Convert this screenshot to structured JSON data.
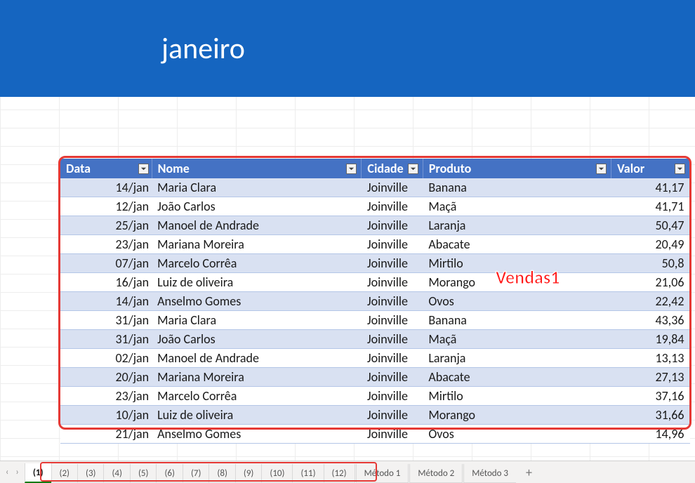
{
  "banner": {
    "title": "janeiro"
  },
  "annotation": "Vendas1",
  "table": {
    "headers": {
      "data": "Data",
      "nome": "Nome",
      "cidade": "Cidade",
      "produto": "Produto",
      "valor": "Valor"
    },
    "rows": [
      {
        "data": "14/jan",
        "nome": "Maria Clara",
        "cidade": "Joinville",
        "produto": "Banana",
        "valor": "41,17"
      },
      {
        "data": "12/jan",
        "nome": "João Carlos",
        "cidade": "Joinville",
        "produto": "Maçã",
        "valor": "41,71"
      },
      {
        "data": "25/jan",
        "nome": "Manoel de Andrade",
        "cidade": "Joinville",
        "produto": "Laranja",
        "valor": "50,47"
      },
      {
        "data": "23/jan",
        "nome": "Mariana Moreira",
        "cidade": "Joinville",
        "produto": "Abacate",
        "valor": "20,49"
      },
      {
        "data": "07/jan",
        "nome": "Marcelo Corrêa",
        "cidade": "Joinville",
        "produto": "Mirtilo",
        "valor": "50,8"
      },
      {
        "data": "16/jan",
        "nome": "Luiz de oliveira",
        "cidade": "Joinville",
        "produto": "Morango",
        "valor": "21,06"
      },
      {
        "data": "14/jan",
        "nome": "Anselmo Gomes",
        "cidade": "Joinville",
        "produto": "Ovos",
        "valor": "22,42"
      },
      {
        "data": "31/jan",
        "nome": "Maria Clara",
        "cidade": "Joinville",
        "produto": "Banana",
        "valor": "43,36"
      },
      {
        "data": "31/jan",
        "nome": "João Carlos",
        "cidade": "Joinville",
        "produto": "Maçã",
        "valor": "19,84"
      },
      {
        "data": "02/jan",
        "nome": "Manoel de Andrade",
        "cidade": "Joinville",
        "produto": "Laranja",
        "valor": "13,13"
      },
      {
        "data": "20/jan",
        "nome": "Mariana Moreira",
        "cidade": "Joinville",
        "produto": "Abacate",
        "valor": "27,13"
      },
      {
        "data": "23/jan",
        "nome": "Marcelo Corrêa",
        "cidade": "Joinville",
        "produto": "Mirtilo",
        "valor": "37,16"
      },
      {
        "data": "10/jan",
        "nome": "Luiz de oliveira",
        "cidade": "Joinville",
        "produto": "Morango",
        "valor": "31,66"
      },
      {
        "data": "21/jan",
        "nome": "Anselmo Gomes",
        "cidade": "Joinville",
        "produto": "Ovos",
        "valor": "14,96"
      }
    ]
  },
  "tabs": {
    "numbered": [
      "(1)",
      "(2)",
      "(3)",
      "(4)",
      "(5)",
      "(6)",
      "(7)",
      "(8)",
      "(9)",
      "(10)",
      "(11)",
      "(12)"
    ],
    "active": "(1)",
    "methods": [
      "Método 1",
      "Método 2",
      "Método 3"
    ],
    "add": "+"
  },
  "nav": {
    "prev": "‹",
    "next": "›"
  }
}
